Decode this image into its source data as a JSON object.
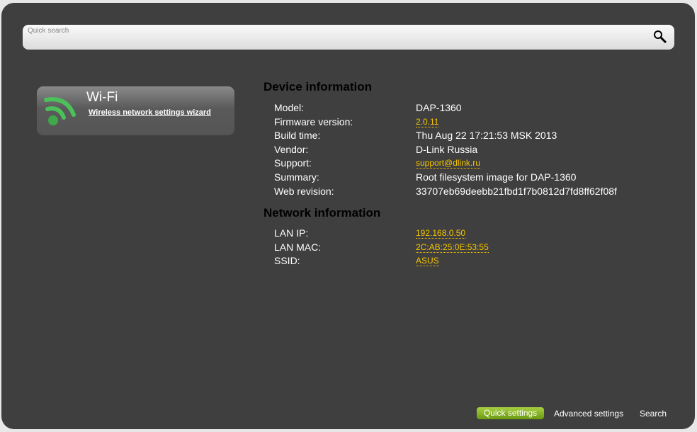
{
  "search": {
    "placeholder": "Quick search"
  },
  "wifi_card": {
    "title": "Wi-Fi",
    "link": "Wireless network settings wizard"
  },
  "device": {
    "heading": "Device information",
    "rows": [
      {
        "label": "Model:",
        "value": "DAP-1360"
      },
      {
        "label": "Firmware version:",
        "value": "2.0.11"
      },
      {
        "label": "Build time:",
        "value": "Thu Aug 22 17:21:53 MSK 2013"
      },
      {
        "label": "Vendor:",
        "value": "D-Link Russia"
      },
      {
        "label": "Support:",
        "value": "support@dlink.ru"
      },
      {
        "label": "Summary:",
        "value": "Root filesystem image for DAP-1360"
      },
      {
        "label": "Web revision:",
        "value": "33707eb69deebb21fbd1f7b0812d7fd8ff62f08f"
      }
    ]
  },
  "network": {
    "heading": "Network information",
    "rows": [
      {
        "label": "LAN IP:",
        "value": "192.168.0.50"
      },
      {
        "label": "LAN MAC:",
        "value": "2C:AB:25:0E:53:55"
      },
      {
        "label": "SSID:",
        "value": "ASUS"
      }
    ]
  },
  "footer": {
    "quick": "Quick settings",
    "advanced": "Advanced settings",
    "search": "Search"
  }
}
